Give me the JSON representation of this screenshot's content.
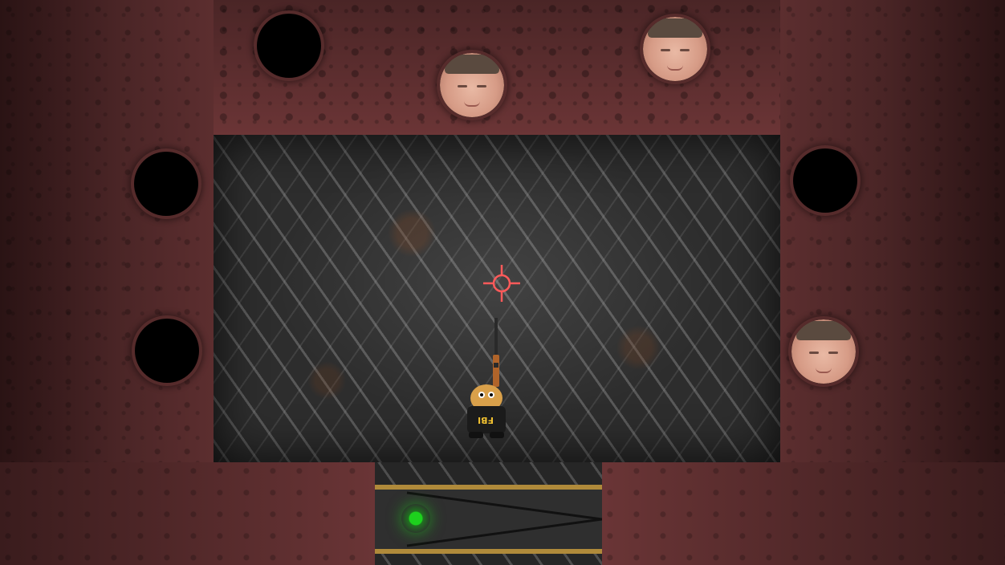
{
  "game": {
    "player": {
      "vest_label": "FBI",
      "weapon": "shotgun"
    },
    "crosshair": {
      "icon": "crosshair-icon",
      "color": "#ff5a5a"
    },
    "exit": {
      "light_color": "#1dd11d",
      "stripe_color": "#b08a3a"
    },
    "holes": [
      {
        "id": "top-left",
        "occupied": false
      },
      {
        "id": "top-center",
        "occupied": true
      },
      {
        "id": "top-right",
        "occupied": true
      },
      {
        "id": "left-upper",
        "occupied": false
      },
      {
        "id": "left-lower",
        "occupied": false
      },
      {
        "id": "right-upper",
        "occupied": false
      },
      {
        "id": "right-lower",
        "occupied": true
      }
    ]
  }
}
